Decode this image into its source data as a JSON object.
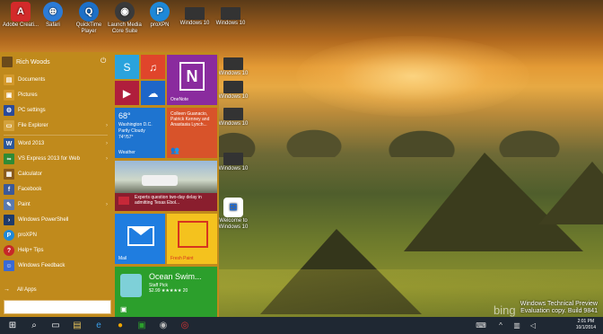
{
  "desktop": {
    "icons_top": [
      {
        "label": "Adobe Creati...",
        "icon": "adobe-cc-icon",
        "color": "#d32a2a"
      },
      {
        "label": "Safari",
        "icon": "safari-icon",
        "color": "#2c7bd6"
      },
      {
        "label": "QuickTime Player",
        "icon": "quicktime-icon",
        "color": "#1d70c8"
      },
      {
        "label": "Launch Media Core Suite",
        "icon": "media-suite-icon",
        "color": "#3a3a3a"
      },
      {
        "label": "proXPN",
        "icon": "proxpn-icon",
        "color": "#1e88d8"
      },
      {
        "label": "Windows 10",
        "icon": "windows-screenshot-icon",
        "color": "#333"
      },
      {
        "label": "Windows 10",
        "icon": "windows-screenshot-icon",
        "color": "#333"
      }
    ],
    "icons_right": [
      {
        "label": "Windows 10",
        "icon": "windows-screenshot-icon"
      },
      {
        "label": "Windows 10",
        "icon": "windows-screenshot-icon"
      },
      {
        "label": "Windows 10",
        "icon": "windows-screenshot-icon"
      },
      {
        "label": "Windows 10",
        "icon": "windows-screenshot-icon"
      },
      {
        "label": "Welcome to Windows 10",
        "icon": "windows-logo-icon"
      }
    ]
  },
  "start_menu": {
    "user_name": "Rich Woods",
    "items": [
      {
        "label": "Documents",
        "icon": "documents-icon",
        "color": "#d49a2c"
      },
      {
        "label": "Pictures",
        "icon": "pictures-icon",
        "color": "#d49a2c"
      },
      {
        "label": "PC settings",
        "icon": "gear-icon",
        "color": "#2a4a9a"
      },
      {
        "label": "File Explorer",
        "icon": "folder-icon",
        "color": "#d4a23c"
      },
      {
        "label": "Word 2013",
        "icon": "word-icon",
        "color": "#2b579a"
      },
      {
        "label": "VS Express 2013 for Web",
        "icon": "visual-studio-icon",
        "color": "#2f8b34"
      },
      {
        "label": "Calculator",
        "icon": "calculator-icon",
        "color": "#8a5a1a"
      },
      {
        "label": "Facebook",
        "icon": "facebook-icon",
        "color": "#3b5998"
      },
      {
        "label": "Paint",
        "icon": "paint-icon",
        "color": "#5a7ab0"
      },
      {
        "label": "Windows PowerShell",
        "icon": "powershell-icon",
        "color": "#1e3a6a"
      },
      {
        "label": "proXPN",
        "icon": "proxpn-icon",
        "color": "#1e88d8"
      },
      {
        "label": "Help+ Tips",
        "icon": "help-icon",
        "color": "#c62828"
      },
      {
        "label": "Windows Feedback",
        "icon": "feedback-icon",
        "color": "#3a6ad4"
      }
    ],
    "all_apps": "All Apps"
  },
  "tiles": {
    "weather": {
      "temp": "68°",
      "place": "Washington D.C.",
      "cond": "Partly Cloudy",
      "range": "74°/57°",
      "caption": "Weather"
    },
    "people": {
      "text": "Colleen Guanacio, Patrick Kenney and Anastasia Lynch...",
      "caption": ""
    },
    "news": {
      "headline": "Experts question two-day delay in admitting Texas Ebol..."
    },
    "onenote": {
      "caption": "OneNote"
    },
    "mail": {
      "caption": "Mail"
    },
    "freshpaint": {
      "caption": "Fresh Paint"
    },
    "store": {
      "title": "Ocean Swim...",
      "sub": "Staff Pick",
      "price": "$2.99 ★★★★★ 20"
    }
  },
  "watermark": {
    "line1": "Windows Technical Preview",
    "line2": "Evaluation copy. Build 9841",
    "bing": "bing"
  },
  "clock": {
    "time": "2:01 PM",
    "date": "10/1/2014"
  },
  "colors": {
    "start_bg": "#c08a1c",
    "taskbar": "#1f2833",
    "accent": "#e8a52e"
  }
}
